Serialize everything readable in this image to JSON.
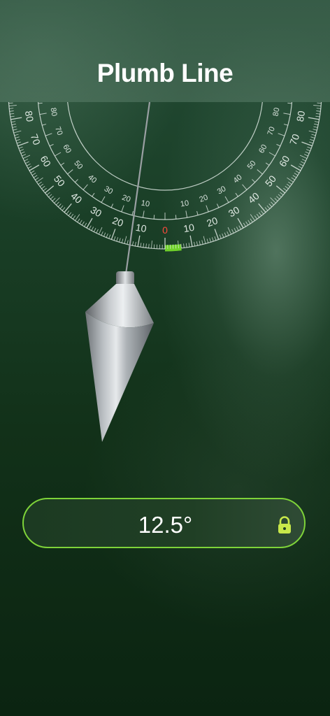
{
  "header": {
    "title": "Plumb Line"
  },
  "protractor": {
    "scale_labels": [
      "0",
      "10",
      "20",
      "30",
      "40",
      "50",
      "60",
      "70",
      "80"
    ],
    "zero_label_color": "#ff4a3d",
    "indicator_color": "#6fd02a"
  },
  "readout": {
    "angle": "12.5°",
    "locked": true,
    "lock_icon": "lock-icon",
    "accent_color": "#7ed339"
  }
}
